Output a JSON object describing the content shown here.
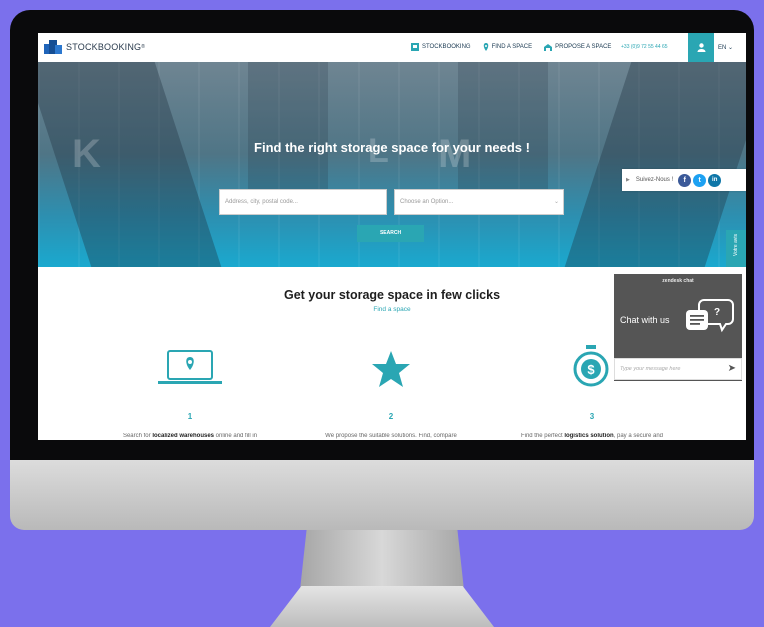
{
  "brand": {
    "name": "STOCKBOOKING",
    "suffix": "®"
  },
  "nav": {
    "links": [
      {
        "label": "STOCKBOOKING",
        "icon": "bookmark-icon"
      },
      {
        "label": "FIND A SPACE",
        "icon": "location-pin-icon"
      },
      {
        "label": "PROPOSE A SPACE",
        "icon": "warehouse-icon"
      }
    ],
    "phone": "+33 (0)9 72 55 44 65",
    "lang": "EN ⌄"
  },
  "hero": {
    "title": "Find the right storage space for your needs !",
    "letters": [
      "K",
      "L",
      "M"
    ],
    "address_placeholder": "Address, city, postal code...",
    "option_select": "Choose an Option...",
    "search_label": "SEARCH"
  },
  "follow": {
    "label": "Suivez-Nous !",
    "networks": [
      "facebook-icon",
      "twitter-icon",
      "linkedin-icon"
    ]
  },
  "side_tab": {
    "label": "Votre avis"
  },
  "section": {
    "title": "Get your storage space in few clicks",
    "subtitle": "Find a space"
  },
  "steps": [
    {
      "num": "1",
      "icon": "laptop-location-icon",
      "text_pre": "Search for ",
      "text_bold": "localized warehouses",
      "text_post": " online and fill in"
    },
    {
      "num": "2",
      "icon": "star-icon",
      "text_pre": "We propose the suitable solutions. Find, compare",
      "text_bold": "",
      "text_post": ""
    },
    {
      "num": "3",
      "icon": "dollar-refresh-icon",
      "text_pre": "Find the perfect ",
      "text_bold": "logistics solution",
      "text_post": ", pay a secure and"
    }
  ],
  "chat": {
    "brand": "zendesk chat",
    "label": "Chat with us",
    "input_placeholder": "Type your message here",
    "send_icon": "send-arrow-icon"
  },
  "colors": {
    "accent": "#2aa6b3",
    "background": "#7b70ec"
  }
}
